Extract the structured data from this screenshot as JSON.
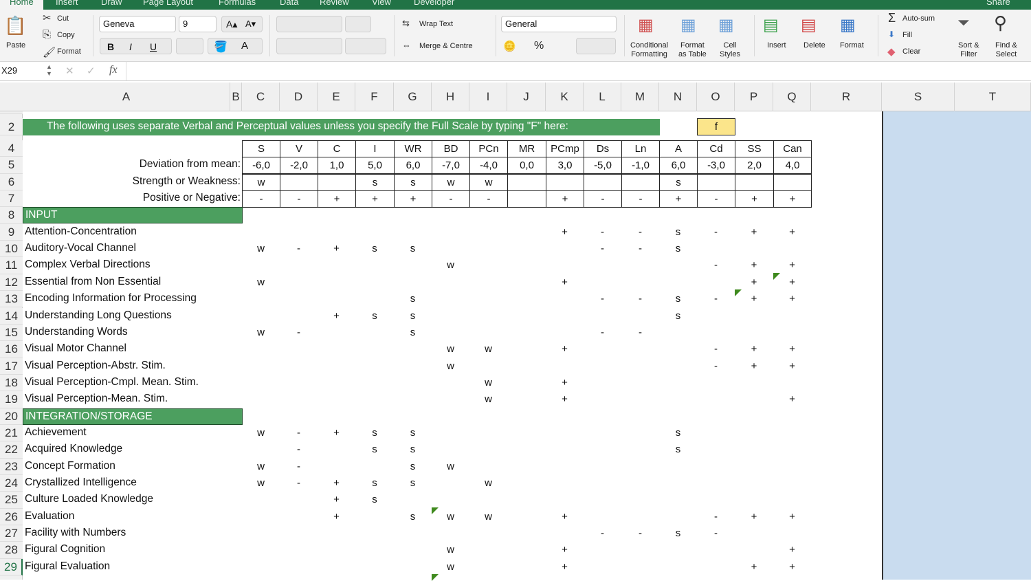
{
  "ribbon_tabs": [
    "Home",
    "Insert",
    "Draw",
    "Page Layout",
    "Formulas",
    "Data",
    "Review",
    "View",
    "Developer"
  ],
  "share_label": "Share",
  "clipboard": {
    "paste": "Paste",
    "cut": "Cut",
    "copy": "Copy",
    "format": "Format"
  },
  "font": {
    "name": "Geneva",
    "size": "9"
  },
  "alignment": {
    "wrap_text": "Wrap Text",
    "merge": "Merge & Centre"
  },
  "number": {
    "format": "General",
    "percent": "%"
  },
  "styles": {
    "conditional": "Conditional",
    "conditional2": "Formatting",
    "format_table": "Format",
    "format_table2": "as Table",
    "cell_styles": "Cell",
    "cell_styles2": "Styles"
  },
  "cells": {
    "insert": "Insert",
    "delete": "Delete",
    "format": "Format"
  },
  "editing": {
    "autosum": "Auto-sum",
    "fill": "Fill",
    "clear": "Clear",
    "sort": "Sort &",
    "sort2": "Filter",
    "find": "Find &",
    "find2": "Select"
  },
  "formula_bar": {
    "name_box": "X29",
    "fx": "fx",
    "value": ""
  },
  "columns": [
    "A",
    "B",
    "C",
    "D",
    "E",
    "F",
    "G",
    "H",
    "I",
    "J",
    "K",
    "L",
    "M",
    "N",
    "O",
    "P",
    "Q",
    "R",
    "S",
    "T"
  ],
  "banner": "The following uses separate Verbal and Perceptual values unless you specify the Full Scale by typing \"F\" here:",
  "full_scale_input": "f",
  "subtests": [
    "S",
    "V",
    "C",
    "I",
    "WR",
    "BD",
    "PCn",
    "MR",
    "PCmp",
    "Ds",
    "Ln",
    "A",
    "Cd",
    "SS",
    "Can"
  ],
  "summary_rows": [
    {
      "row": "5",
      "label": "Deviation from mean:",
      "values": [
        "-6,0",
        "-2,0",
        "1,0",
        "5,0",
        "6,0",
        "-7,0",
        "-4,0",
        "0,0",
        "3,0",
        "-5,0",
        "-1,0",
        "6,0",
        "-3,0",
        "2,0",
        "4,0"
      ]
    },
    {
      "row": "6",
      "label": "Strength or Weakness:",
      "values": [
        "w",
        "",
        "",
        "s",
        "s",
        "w",
        "w",
        "",
        "",
        "",
        "",
        "s",
        "",
        "",
        ""
      ]
    },
    {
      "row": "7",
      "label": "Positive or Negative:",
      "values": [
        "-",
        "-",
        "+",
        "+",
        "+",
        "-",
        "-",
        "",
        "+",
        "-",
        "-",
        "+",
        "-",
        "+",
        "+"
      ]
    }
  ],
  "sections": [
    {
      "row": "8",
      "title": "INPUT"
    },
    {
      "row": "20",
      "title": "INTEGRATION/STORAGE"
    }
  ],
  "ability_rows": [
    {
      "row": "9",
      "label": "Attention-Concentration",
      "v": {
        "K": "+",
        "L": "-",
        "M": "-",
        "N": "s",
        "O": "-",
        "P": "+",
        "Q": "+"
      }
    },
    {
      "row": "10",
      "label": "Auditory-Vocal Channel",
      "v": {
        "C": "w",
        "D": "-",
        "E": "+",
        "F": "s",
        "G": "s",
        "L": "-",
        "M": "-",
        "N": "s"
      }
    },
    {
      "row": "11",
      "label": "Complex Verbal Directions",
      "v": {
        "H": "w",
        "O": "-",
        "P": "+",
        "Q": "+"
      }
    },
    {
      "row": "12",
      "label": "Essential from Non Essential",
      "v": {
        "C": "w",
        "K": "+",
        "P": "+",
        "Q": "+"
      }
    },
    {
      "row": "13",
      "label": "Encoding Information for Processing",
      "v": {
        "G": "s",
        "L": "-",
        "M": "-",
        "N": "s",
        "O": "-",
        "P": "+",
        "Q": "+"
      }
    },
    {
      "row": "14",
      "label": "Understanding Long Questions",
      "v": {
        "E": "+",
        "F": "s",
        "G": "s",
        "N": "s"
      }
    },
    {
      "row": "15",
      "label": "Understanding Words",
      "v": {
        "C": "w",
        "D": "-",
        "G": "s",
        "L": "-",
        "M": "-"
      }
    },
    {
      "row": "16",
      "label": "Visual Motor Channel",
      "v": {
        "H": "w",
        "I": "w",
        "K": "+",
        "O": "-",
        "P": "+",
        "Q": "+"
      }
    },
    {
      "row": "17",
      "label": "Visual Perception-Abstr. Stim.",
      "v": {
        "H": "w",
        "O": "-",
        "P": "+",
        "Q": "+"
      }
    },
    {
      "row": "18",
      "label": "Visual Perception-Cmpl. Mean. Stim.",
      "v": {
        "I": "w",
        "K": "+"
      }
    },
    {
      "row": "19",
      "label": "Visual Perception-Mean. Stim.",
      "v": {
        "I": "w",
        "K": "+",
        "Q": "+"
      }
    },
    {
      "row": "21",
      "label": "Achievement",
      "v": {
        "C": "w",
        "D": "-",
        "E": "+",
        "F": "s",
        "G": "s",
        "N": "s"
      }
    },
    {
      "row": "22",
      "label": "Acquired Knowledge",
      "v": {
        "D": "-",
        "F": "s",
        "G": "s",
        "N": "s"
      }
    },
    {
      "row": "23",
      "label": "Concept Formation",
      "v": {
        "C": "w",
        "D": "-",
        "G": "s",
        "H": "w"
      }
    },
    {
      "row": "24",
      "label": "Crystallized Intelligence",
      "v": {
        "C": "w",
        "D": "-",
        "E": "+",
        "F": "s",
        "G": "s",
        "I": "w"
      }
    },
    {
      "row": "25",
      "label": "Culture Loaded Knowledge",
      "v": {
        "E": "+",
        "F": "s"
      }
    },
    {
      "row": "26",
      "label": "Evaluation",
      "v": {
        "E": "+",
        "G": "s",
        "H": "w",
        "I": "w",
        "K": "+",
        "O": "-",
        "P": "+",
        "Q": "+"
      }
    },
    {
      "row": "27",
      "label": "Facility with Numbers",
      "v": {
        "L": "-",
        "M": "-",
        "N": "s",
        "O": "-"
      }
    },
    {
      "row": "28",
      "label": "Figural Cognition",
      "v": {
        "H": "w",
        "K": "+",
        "Q": "+"
      }
    },
    {
      "row": "29",
      "label": "Figural Evaluation",
      "v": {
        "H": "w",
        "K": "+",
        "P": "+",
        "Q": "+"
      }
    }
  ],
  "row_numbers": [
    "2",
    "4",
    "5",
    "6",
    "7",
    "8",
    "9",
    "10",
    "11",
    "12",
    "13",
    "14",
    "15",
    "16",
    "17",
    "18",
    "19",
    "20",
    "21",
    "22",
    "23",
    "24",
    "25",
    "26",
    "27",
    "28",
    "29"
  ],
  "colors": {
    "excel_green": "#217346",
    "header_green": "#4c9f5f",
    "input_yellow": "#fbe58b",
    "selection_blue": "#c9dcef"
  }
}
